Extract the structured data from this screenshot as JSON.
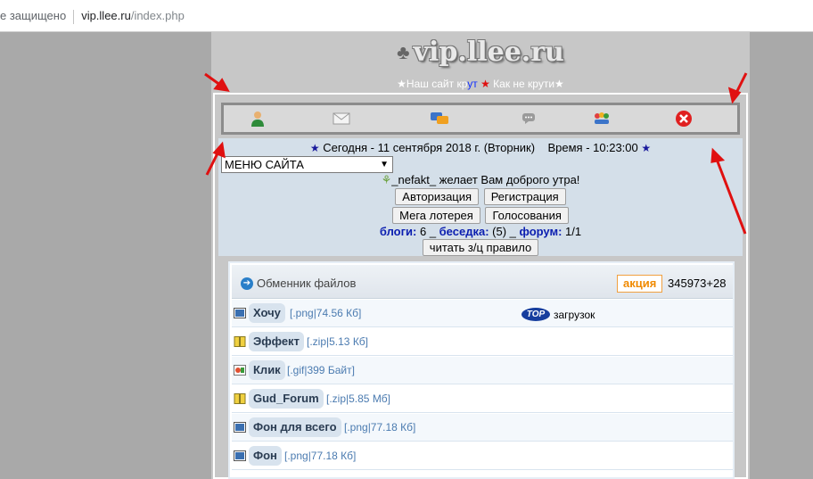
{
  "browser": {
    "security_text": "е защищено",
    "url_host": "vip.llee.ru",
    "url_path": "/index.php"
  },
  "site": {
    "logo_text": "vip.llee.ru",
    "tagline": {
      "part1": "★Наш сайт кр",
      "part2": "ут",
      "part3": " ",
      "star": "★",
      "part4": " Как не крути★"
    },
    "icons": [
      {
        "name": "user-icon",
        "glyph": "👤"
      },
      {
        "name": "mail-icon",
        "glyph": "✉"
      },
      {
        "name": "chat-icon",
        "glyph": "💬"
      },
      {
        "name": "comment-icon",
        "glyph": "💬"
      },
      {
        "name": "group-icon",
        "glyph": "👥"
      },
      {
        "name": "close-icon",
        "glyph": "✕"
      }
    ],
    "info": {
      "date_text": "Сегодня - 11 сентября 2018 г. (Вторник)",
      "time_text": "Время - 10:23:00",
      "menu_value": "МЕНЮ САЙТА",
      "greeting": "_nefakt_ желает Вам доброго утра!",
      "buttons": {
        "auth": "Авторизация",
        "register": "Регистрация",
        "lottery": "Мега лотерея",
        "votes": "Голосования",
        "rules": "читать з/ц правило"
      },
      "stats": {
        "blogs_label": "блоги:",
        "blogs_value": " 6 _ ",
        "beseda_label": "беседка:",
        "beseda_value": " (5) _ ",
        "forum_label": "форум:",
        "forum_value": " 1/1"
      }
    },
    "content": {
      "header_title": "Обменник файлов",
      "akcia": "акция",
      "count": "345973+28",
      "top_badge": "TOP",
      "top_text": "загрузок",
      "files": [
        {
          "name": "Хочу",
          "meta": "[.png|74.56 Кб]",
          "type": "image"
        },
        {
          "name": "Эффект",
          "meta": "[.zip|5.13 Кб]",
          "type": "zip"
        },
        {
          "name": "Клик",
          "meta": "[.gif|399 Байт]",
          "type": "gif"
        },
        {
          "name": "Gud_Forum",
          "meta": "[.zip|5.85 Мб]",
          "type": "zip"
        },
        {
          "name": "Фон для всего",
          "meta": "[.png|77.18 Кб]",
          "type": "image"
        },
        {
          "name": "Фон",
          "meta": "[.png|77.18 Кб]",
          "type": "image"
        }
      ]
    }
  },
  "colors": {
    "outer_bg": "#a9a9a9",
    "site_bg": "#c7c7c7",
    "info_bg": "#d4dfe9",
    "link_blue": "#0b1eb0",
    "accent_orange": "#f08a00",
    "arrow_red": "#e01010"
  }
}
